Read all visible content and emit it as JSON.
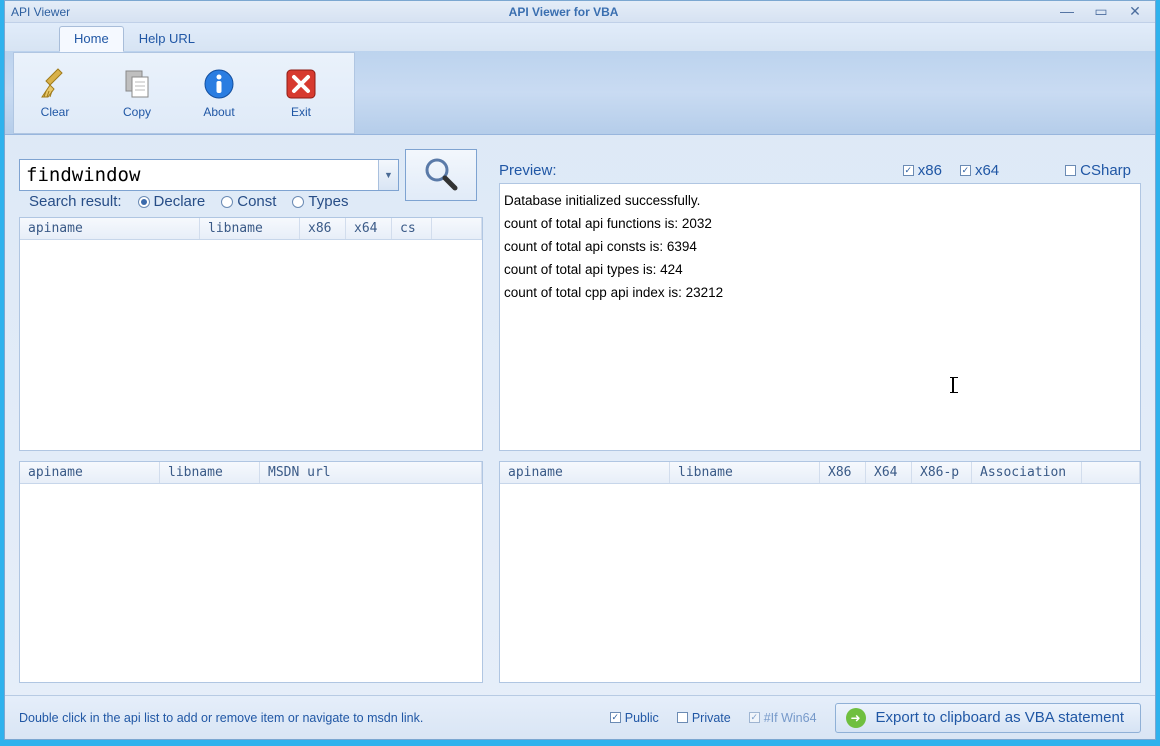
{
  "title_left": "API Viewer",
  "title_center": "API Viewer for VBA",
  "tabs": {
    "home": "Home",
    "help": "Help URL"
  },
  "ribbon": {
    "clear": "Clear",
    "copy": "Copy",
    "about": "About",
    "exit": "Exit"
  },
  "search": {
    "value": "findwindow",
    "label": "Search result:"
  },
  "radios": {
    "declare": "Declare",
    "const": "Const",
    "types": "Types"
  },
  "preview_label": "Preview:",
  "checks": {
    "x86": "x86",
    "x64": "x64",
    "csharp": "CSharp"
  },
  "preview_lines": {
    "l0": "Database initialized successfully.",
    "l1": "count of total api functions is: 2032",
    "l2": "count of total api consts is: 6394",
    "l3": "count of total api types is: 424",
    "l4": "count of total cpp api index is: 23212"
  },
  "grid1_cols": {
    "c0": "apiname",
    "c1": "libname",
    "c2": "x86",
    "c3": "x64",
    "c4": "cs"
  },
  "grid2_cols": {
    "c0": "apiname",
    "c1": "libname",
    "c2": "MSDN url"
  },
  "grid3_cols": {
    "c0": "apiname",
    "c1": "libname",
    "c2": "X86",
    "c3": "X64",
    "c4": "X86-p",
    "c5": "Association"
  },
  "status": {
    "hint": "Double click in the api list to add or remove item or navigate to msdn link.",
    "public": "Public",
    "private": "Private",
    "ifwin64": "#If Win64",
    "export": "Export to clipboard as VBA statement"
  }
}
